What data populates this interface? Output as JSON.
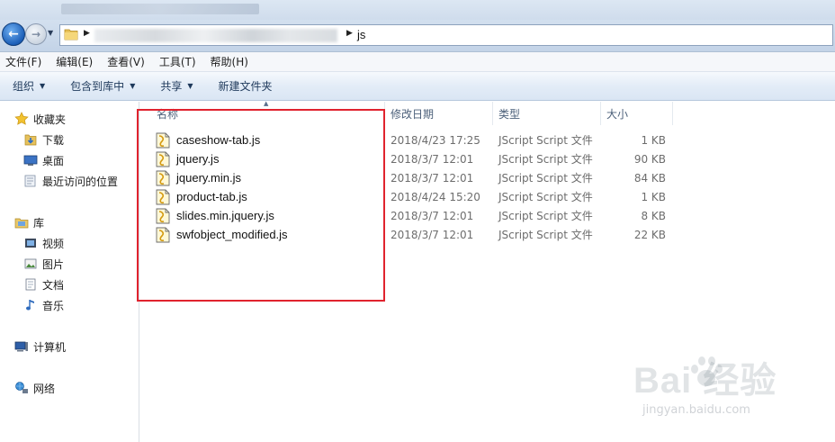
{
  "address": {
    "current_folder": "js"
  },
  "menu": [
    "文件(F)",
    "编辑(E)",
    "查看(V)",
    "工具(T)",
    "帮助(H)"
  ],
  "toolbar": {
    "organize": "组织",
    "include_in_library": "包含到库中",
    "share": "共享",
    "new_folder": "新建文件夹"
  },
  "sidebar": {
    "favorites": {
      "label": "收藏夹",
      "icon": "star-icon"
    },
    "favorites_items": [
      {
        "label": "下载",
        "icon": "downloads-folder-icon"
      },
      {
        "label": "桌面",
        "icon": "desktop-icon"
      },
      {
        "label": "最近访问的位置",
        "icon": "recent-places-icon"
      }
    ],
    "libraries": {
      "label": "库",
      "icon": "library-icon"
    },
    "library_items": [
      {
        "label": "视频",
        "icon": "video-library-icon"
      },
      {
        "label": "图片",
        "icon": "pictures-library-icon"
      },
      {
        "label": "文档",
        "icon": "documents-library-icon"
      },
      {
        "label": "音乐",
        "icon": "music-library-icon"
      }
    ],
    "computer": {
      "label": "计算机",
      "icon": "computer-icon"
    },
    "network": {
      "label": "网络",
      "icon": "network-icon"
    }
  },
  "columns": {
    "name": "名称",
    "date": "修改日期",
    "type": "类型",
    "size": "大小"
  },
  "files": [
    {
      "name": "caseshow-tab.js",
      "date": "2018/4/23 17:25",
      "type": "JScript Script 文件",
      "size": "1 KB"
    },
    {
      "name": "jquery.js",
      "date": "2018/3/7 12:01",
      "type": "JScript Script 文件",
      "size": "90 KB"
    },
    {
      "name": "jquery.min.js",
      "date": "2018/3/7 12:01",
      "type": "JScript Script 文件",
      "size": "84 KB"
    },
    {
      "name": "product-tab.js",
      "date": "2018/4/24 15:20",
      "type": "JScript Script 文件",
      "size": "1 KB"
    },
    {
      "name": "slides.min.jquery.js",
      "date": "2018/3/7 12:01",
      "type": "JScript Script 文件",
      "size": "8 KB"
    },
    {
      "name": "swfobject_modified.js",
      "date": "2018/3/7 12:01",
      "type": "JScript Script 文件",
      "size": "22 KB"
    }
  ],
  "annotation": {
    "highlight_color": "#e0232e"
  },
  "watermark": {
    "logo": "Bai  经验",
    "url": "jingyan.baidu.com"
  }
}
